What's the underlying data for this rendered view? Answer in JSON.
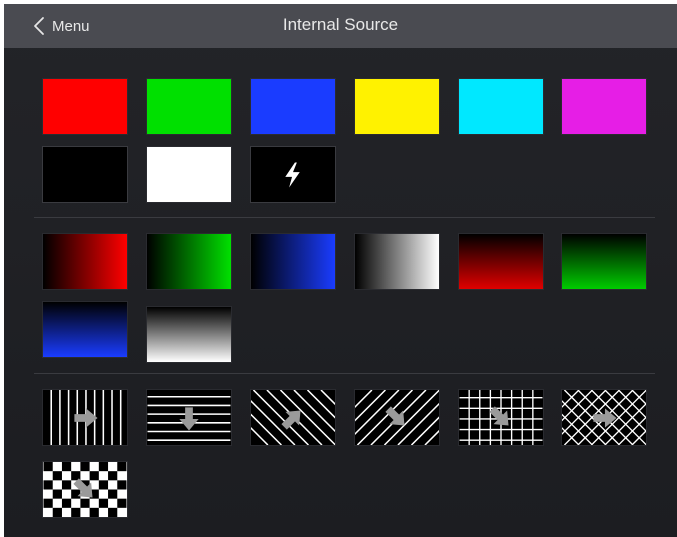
{
  "header": {
    "back_label": "Menu",
    "title": "Internal Source"
  },
  "solid_colors": [
    {
      "name": "red",
      "color": "#ff0000"
    },
    {
      "name": "green",
      "color": "#00e000"
    },
    {
      "name": "blue",
      "color": "#1a3cff"
    },
    {
      "name": "yellow",
      "color": "#fff200"
    },
    {
      "name": "cyan",
      "color": "#00e8ff"
    },
    {
      "name": "magenta",
      "color": "#e61ee6"
    },
    {
      "name": "black",
      "color": "#000000"
    },
    {
      "name": "white",
      "color": "#ffffff"
    }
  ],
  "special_tile": {
    "icon": "lightning-icon",
    "background": "#000000"
  },
  "gradients": [
    {
      "name": "red-horizontal",
      "direction": "horizontal",
      "color": "#ff0000"
    },
    {
      "name": "green-horizontal",
      "direction": "horizontal",
      "color": "#00e000"
    },
    {
      "name": "blue-horizontal",
      "direction": "horizontal",
      "color": "#1a3cff"
    },
    {
      "name": "gray-horizontal",
      "direction": "horizontal",
      "color": "#ffffff"
    },
    {
      "name": "red-vertical",
      "direction": "vertical",
      "color": "#e00000"
    },
    {
      "name": "green-vertical",
      "direction": "vertical",
      "color": "#00cc00"
    },
    {
      "name": "blue-vertical",
      "direction": "vertical",
      "color": "#1a3cff"
    },
    {
      "name": "gray-vertical",
      "direction": "vertical",
      "color": "#ffffff"
    }
  ],
  "patterns": [
    {
      "name": "vertical-lines",
      "icon": "arrow-right-icon"
    },
    {
      "name": "horizontal-lines",
      "icon": "arrow-down-icon"
    },
    {
      "name": "diagonal-lines-up",
      "icon": "arrow-up-right-icon"
    },
    {
      "name": "diagonal-lines-down",
      "icon": "arrow-down-right-icon"
    },
    {
      "name": "grid",
      "icon": "arrow-down-right-icon"
    },
    {
      "name": "crosshatch",
      "icon": "arrow-right-icon"
    },
    {
      "name": "checkerboard",
      "icon": "arrow-down-right-icon"
    }
  ]
}
